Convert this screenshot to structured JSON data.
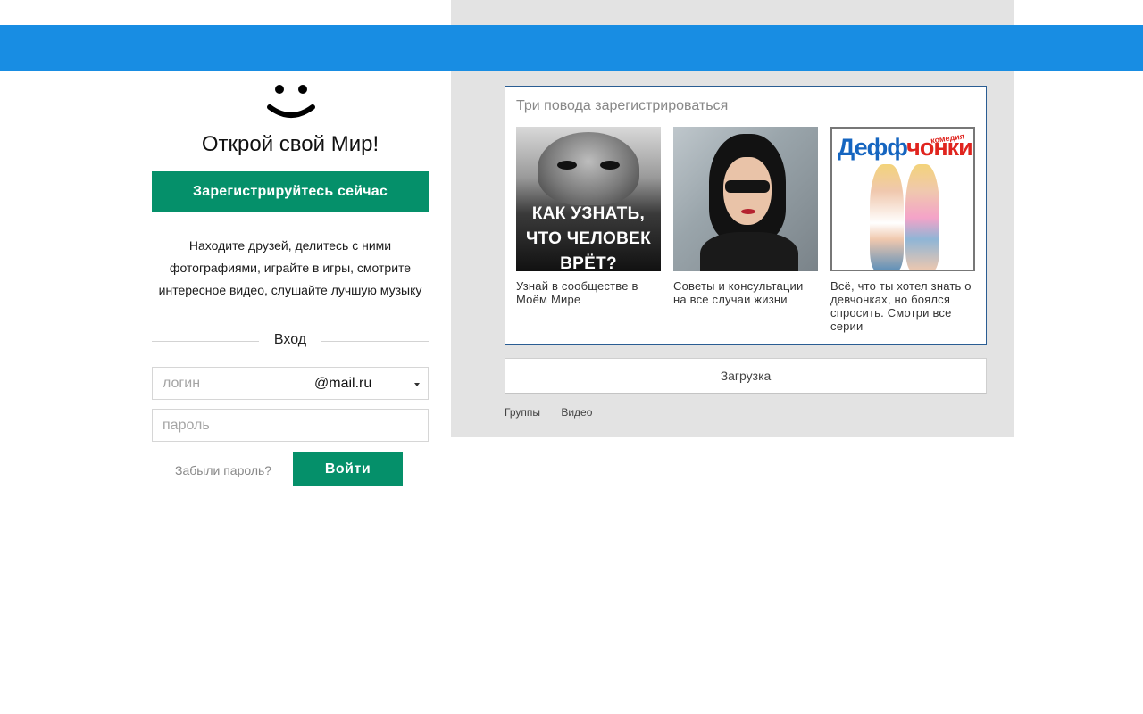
{
  "header": {
    "color": "#188de3"
  },
  "left": {
    "logo_icon": "smile-icon",
    "headline": "Открой свой Мир!",
    "register_label": "Зарегистрируйтесь сейчас",
    "description": "Находите друзей, делитесь с ними фотографиями, играйте в игры, смотрите интересное видео, слушайте лучшую музыку",
    "login": {
      "title": "Вход",
      "login_placeholder": "логин",
      "domain": "@mail.ru",
      "password_placeholder": "пароль",
      "forgot_label": "Забыли пароль?",
      "enter_label": "Войти"
    }
  },
  "promo": {
    "title": "Три повода зарегистрироваться",
    "cards": [
      {
        "image_text": "КАК УЗНАТЬ, ЧТО ЧЕЛОВЕК ВРЁТ?",
        "caption": "Узнай в сообществе в Моём Мире"
      },
      {
        "caption": "Советы и консультации на все случаи жизни"
      },
      {
        "brand_part1": "Дефф",
        "brand_part2": "чонки",
        "brand_tag": "комедия",
        "caption": "Всё, что ты хотел знать о девчонках, но боялся спросить. Смотри все серии"
      }
    ]
  },
  "loading_label": "Загрузка",
  "footer_links": [
    "Группы",
    "Видео"
  ],
  "colors": {
    "accent_green": "#05906a",
    "promo_border": "#2a5d93",
    "panel_gray": "#e3e3e3"
  }
}
